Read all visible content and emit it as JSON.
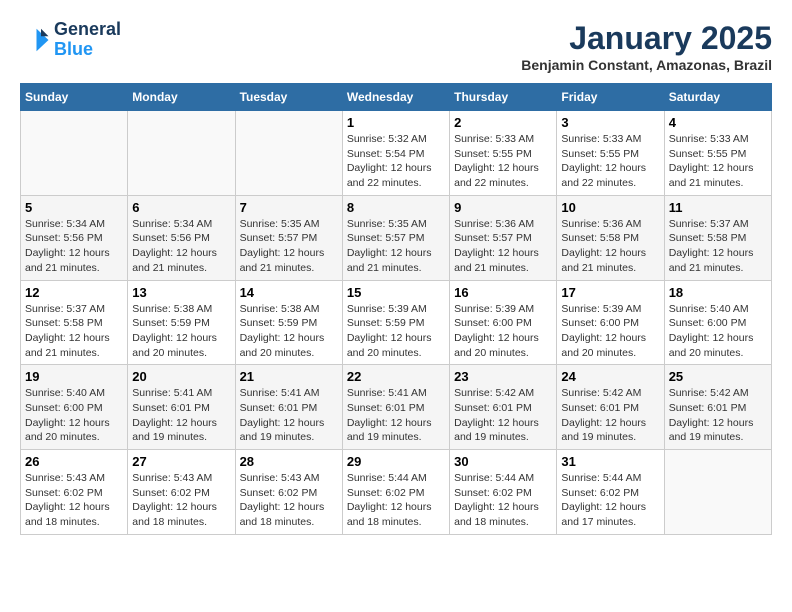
{
  "header": {
    "logo_line1": "General",
    "logo_line2": "Blue",
    "month_title": "January 2025",
    "subtitle": "Benjamin Constant, Amazonas, Brazil"
  },
  "days_of_week": [
    "Sunday",
    "Monday",
    "Tuesday",
    "Wednesday",
    "Thursday",
    "Friday",
    "Saturday"
  ],
  "weeks": [
    [
      {
        "day": "",
        "info": ""
      },
      {
        "day": "",
        "info": ""
      },
      {
        "day": "",
        "info": ""
      },
      {
        "day": "1",
        "info": "Sunrise: 5:32 AM\nSunset: 5:54 PM\nDaylight: 12 hours and 22 minutes."
      },
      {
        "day": "2",
        "info": "Sunrise: 5:33 AM\nSunset: 5:55 PM\nDaylight: 12 hours and 22 minutes."
      },
      {
        "day": "3",
        "info": "Sunrise: 5:33 AM\nSunset: 5:55 PM\nDaylight: 12 hours and 22 minutes."
      },
      {
        "day": "4",
        "info": "Sunrise: 5:33 AM\nSunset: 5:55 PM\nDaylight: 12 hours and 21 minutes."
      }
    ],
    [
      {
        "day": "5",
        "info": "Sunrise: 5:34 AM\nSunset: 5:56 PM\nDaylight: 12 hours and 21 minutes."
      },
      {
        "day": "6",
        "info": "Sunrise: 5:34 AM\nSunset: 5:56 PM\nDaylight: 12 hours and 21 minutes."
      },
      {
        "day": "7",
        "info": "Sunrise: 5:35 AM\nSunset: 5:57 PM\nDaylight: 12 hours and 21 minutes."
      },
      {
        "day": "8",
        "info": "Sunrise: 5:35 AM\nSunset: 5:57 PM\nDaylight: 12 hours and 21 minutes."
      },
      {
        "day": "9",
        "info": "Sunrise: 5:36 AM\nSunset: 5:57 PM\nDaylight: 12 hours and 21 minutes."
      },
      {
        "day": "10",
        "info": "Sunrise: 5:36 AM\nSunset: 5:58 PM\nDaylight: 12 hours and 21 minutes."
      },
      {
        "day": "11",
        "info": "Sunrise: 5:37 AM\nSunset: 5:58 PM\nDaylight: 12 hours and 21 minutes."
      }
    ],
    [
      {
        "day": "12",
        "info": "Sunrise: 5:37 AM\nSunset: 5:58 PM\nDaylight: 12 hours and 21 minutes."
      },
      {
        "day": "13",
        "info": "Sunrise: 5:38 AM\nSunset: 5:59 PM\nDaylight: 12 hours and 20 minutes."
      },
      {
        "day": "14",
        "info": "Sunrise: 5:38 AM\nSunset: 5:59 PM\nDaylight: 12 hours and 20 minutes."
      },
      {
        "day": "15",
        "info": "Sunrise: 5:39 AM\nSunset: 5:59 PM\nDaylight: 12 hours and 20 minutes."
      },
      {
        "day": "16",
        "info": "Sunrise: 5:39 AM\nSunset: 6:00 PM\nDaylight: 12 hours and 20 minutes."
      },
      {
        "day": "17",
        "info": "Sunrise: 5:39 AM\nSunset: 6:00 PM\nDaylight: 12 hours and 20 minutes."
      },
      {
        "day": "18",
        "info": "Sunrise: 5:40 AM\nSunset: 6:00 PM\nDaylight: 12 hours and 20 minutes."
      }
    ],
    [
      {
        "day": "19",
        "info": "Sunrise: 5:40 AM\nSunset: 6:00 PM\nDaylight: 12 hours and 20 minutes."
      },
      {
        "day": "20",
        "info": "Sunrise: 5:41 AM\nSunset: 6:01 PM\nDaylight: 12 hours and 19 minutes."
      },
      {
        "day": "21",
        "info": "Sunrise: 5:41 AM\nSunset: 6:01 PM\nDaylight: 12 hours and 19 minutes."
      },
      {
        "day": "22",
        "info": "Sunrise: 5:41 AM\nSunset: 6:01 PM\nDaylight: 12 hours and 19 minutes."
      },
      {
        "day": "23",
        "info": "Sunrise: 5:42 AM\nSunset: 6:01 PM\nDaylight: 12 hours and 19 minutes."
      },
      {
        "day": "24",
        "info": "Sunrise: 5:42 AM\nSunset: 6:01 PM\nDaylight: 12 hours and 19 minutes."
      },
      {
        "day": "25",
        "info": "Sunrise: 5:42 AM\nSunset: 6:01 PM\nDaylight: 12 hours and 19 minutes."
      }
    ],
    [
      {
        "day": "26",
        "info": "Sunrise: 5:43 AM\nSunset: 6:02 PM\nDaylight: 12 hours and 18 minutes."
      },
      {
        "day": "27",
        "info": "Sunrise: 5:43 AM\nSunset: 6:02 PM\nDaylight: 12 hours and 18 minutes."
      },
      {
        "day": "28",
        "info": "Sunrise: 5:43 AM\nSunset: 6:02 PM\nDaylight: 12 hours and 18 minutes."
      },
      {
        "day": "29",
        "info": "Sunrise: 5:44 AM\nSunset: 6:02 PM\nDaylight: 12 hours and 18 minutes."
      },
      {
        "day": "30",
        "info": "Sunrise: 5:44 AM\nSunset: 6:02 PM\nDaylight: 12 hours and 18 minutes."
      },
      {
        "day": "31",
        "info": "Sunrise: 5:44 AM\nSunset: 6:02 PM\nDaylight: 12 hours and 17 minutes."
      },
      {
        "day": "",
        "info": ""
      }
    ]
  ]
}
